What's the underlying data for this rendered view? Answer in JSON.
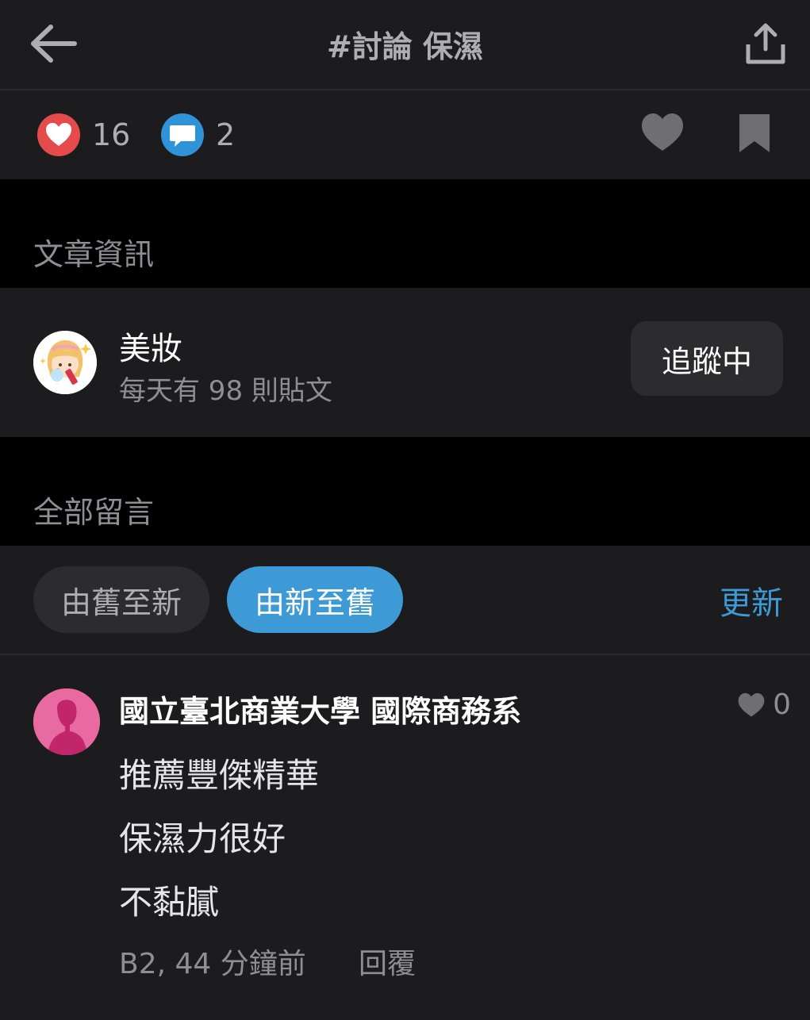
{
  "header": {
    "title": "#討論 保濕",
    "back_icon": "arrow-left-icon",
    "share_icon": "share-upload-icon"
  },
  "stats": {
    "likes": "16",
    "comments": "2",
    "like_color": "#e54b4b",
    "comment_color": "#2f93d8"
  },
  "article_info": {
    "section_label": "文章資訊",
    "board_name": "美妝",
    "board_sub": "每天有 98 則貼文",
    "follow_label": "追蹤中"
  },
  "comments_section": {
    "section_label": "全部留言",
    "sort_old_label": "由舊至新",
    "sort_new_label": "由新至舊",
    "refresh_label": "更新",
    "accent_color": "#3d9ad6"
  },
  "comments": [
    {
      "author": "國立臺北商業大學 國際商務系",
      "likes": "0",
      "lines": [
        "推薦豐傑精華",
        "保濕力很好",
        "不黏膩"
      ],
      "meta": "B2, 44 分鐘前",
      "reply_label": "回覆"
    }
  ]
}
